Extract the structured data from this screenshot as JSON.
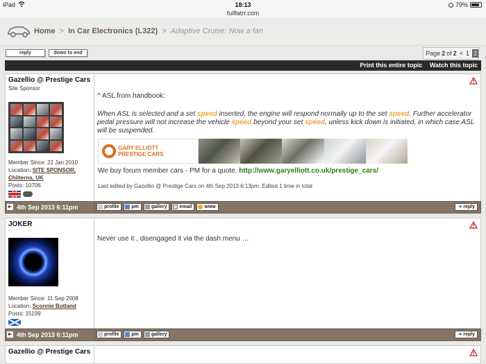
{
  "status_bar": {
    "device": "iPad",
    "time": "18:13",
    "url": "fullfatrr.com",
    "battery": "79%"
  },
  "breadcrumb": {
    "home": "Home",
    "forum": "In Car Electronics (L322)",
    "topic": "Adaptive Cruise: Now a fan",
    "separator": ">"
  },
  "buttons": {
    "reply": "reply",
    "down_to_end": "down to end"
  },
  "pagination": {
    "label": "Page",
    "current": "2",
    "of": "of",
    "total": "2",
    "prev": "<",
    "page1": "1",
    "page2": "2"
  },
  "topic_actions": {
    "print": "Print this entire topic",
    "watch": "Watch this topic"
  },
  "posts": [
    {
      "author": "Gazellio @ Prestige Cars",
      "role": "Site Sponsor",
      "member_since": "Member Since: 22 Jan 2010",
      "location_label": "Location:",
      "location": "SITE SPONSOR, Chilterns, UK",
      "posts": "Posts: 10706",
      "date": "4th Sep 2013 6:11pm",
      "intro": "^ ASL from handbook:",
      "quote": {
        "p1": "When ASL is selected and a set ",
        "w1": "speed",
        "p2": " inserted, the engine will respond normally up to the set ",
        "w2": "speed",
        "p3": ". Further accelerator pedal pressure will not increase the vehicle ",
        "w3": "speed",
        "p4": " beyond your set ",
        "w4": "speed",
        "p5": ", unless kick down is initiated, in which case ASL will be suspended."
      },
      "banner_logo_line1": "GARY ELLIOTT",
      "banner_logo_line2": "PRESTIGE CARS",
      "buy_text": "We buy forum member cars - PM for a quote.",
      "buy_link": "http://www.garyelliott.co.uk/prestige_cars/",
      "edited": "Last edited by Gazellio @ Prestige Cars on 4th Sep 2013 6:13pm. Edited 1 time in total",
      "footer_buttons": [
        "profile",
        "pm",
        "gallery",
        "email",
        "www"
      ],
      "reply": "reply"
    },
    {
      "author": "JOKER",
      "member_since": "Member Since: 11 Sep 2008",
      "location_label": "Location:",
      "location": "Sconnie Botland",
      "posts": "Posts: 15199",
      "date": "4th Sep 2013 6:11pm",
      "text": "Never use it , disengaged it via the dash menu …",
      "footer_buttons": [
        "profile",
        "pm",
        "gallery"
      ],
      "reply": "reply"
    },
    {
      "author": "Gazellio @ Prestige Cars"
    }
  ]
}
